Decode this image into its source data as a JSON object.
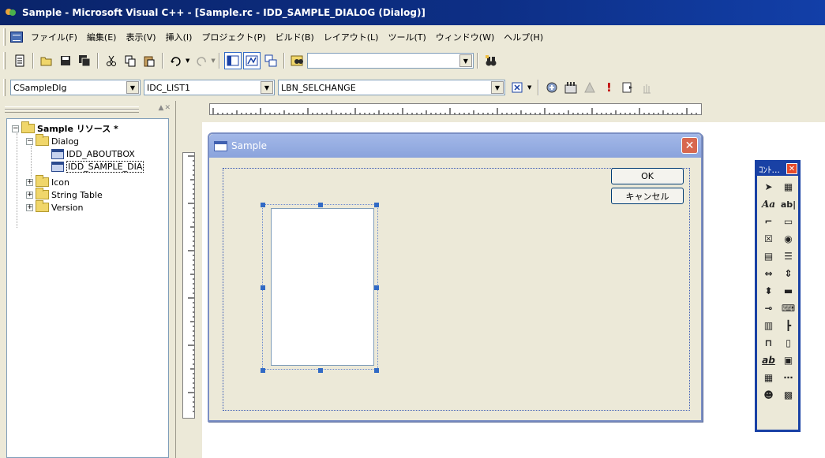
{
  "window": {
    "title": "Sample - Microsoft Visual C++ - [Sample.rc - IDD_SAMPLE_DIALOG (Dialog)]"
  },
  "menubar": {
    "items": [
      "ファイル(F)",
      "編集(E)",
      "表示(V)",
      "挿入(I)",
      "プロジェクト(P)",
      "ビルド(B)",
      "レイアウト(L)",
      "ツール(T)",
      "ウィンドウ(W)",
      "ヘルプ(H)"
    ]
  },
  "wizardbar": {
    "class_combo": "CSampleDlg",
    "id_combo": "IDC_LIST1",
    "message_combo": "LBN_SELCHANGE"
  },
  "workspace": {
    "root": "Sample リソース *",
    "folders": {
      "dialog": "Dialog",
      "icon": "Icon",
      "string_table": "String Table",
      "version": "Version"
    },
    "dialogs": [
      "IDD_ABOUTBOX",
      "IDD_SAMPLE_DIA"
    ]
  },
  "dialog": {
    "title": "Sample",
    "ok_label": "OK",
    "cancel_label": "キャンセル"
  },
  "controls_panel": {
    "title": "ｺﾝﾄ...",
    "tools": [
      "pointer-icon",
      "picture-icon",
      "static-text-icon",
      "edit-box-icon",
      "group-box-icon",
      "push-button-icon",
      "check-box-icon",
      "radio-button-icon",
      "combo-box-icon",
      "list-box-icon",
      "horizontal-scrollbar-icon",
      "vertical-scrollbar-icon",
      "spin-icon",
      "progress-icon",
      "slider-icon",
      "hotkey-icon",
      "list-control-icon",
      "tree-control-icon",
      "tab-control-icon",
      "animate-icon",
      "rich-edit-icon",
      "date-time-icon",
      "month-calendar-icon",
      "ip-address-icon",
      "custom-control-icon",
      "extended-combo-icon"
    ]
  }
}
